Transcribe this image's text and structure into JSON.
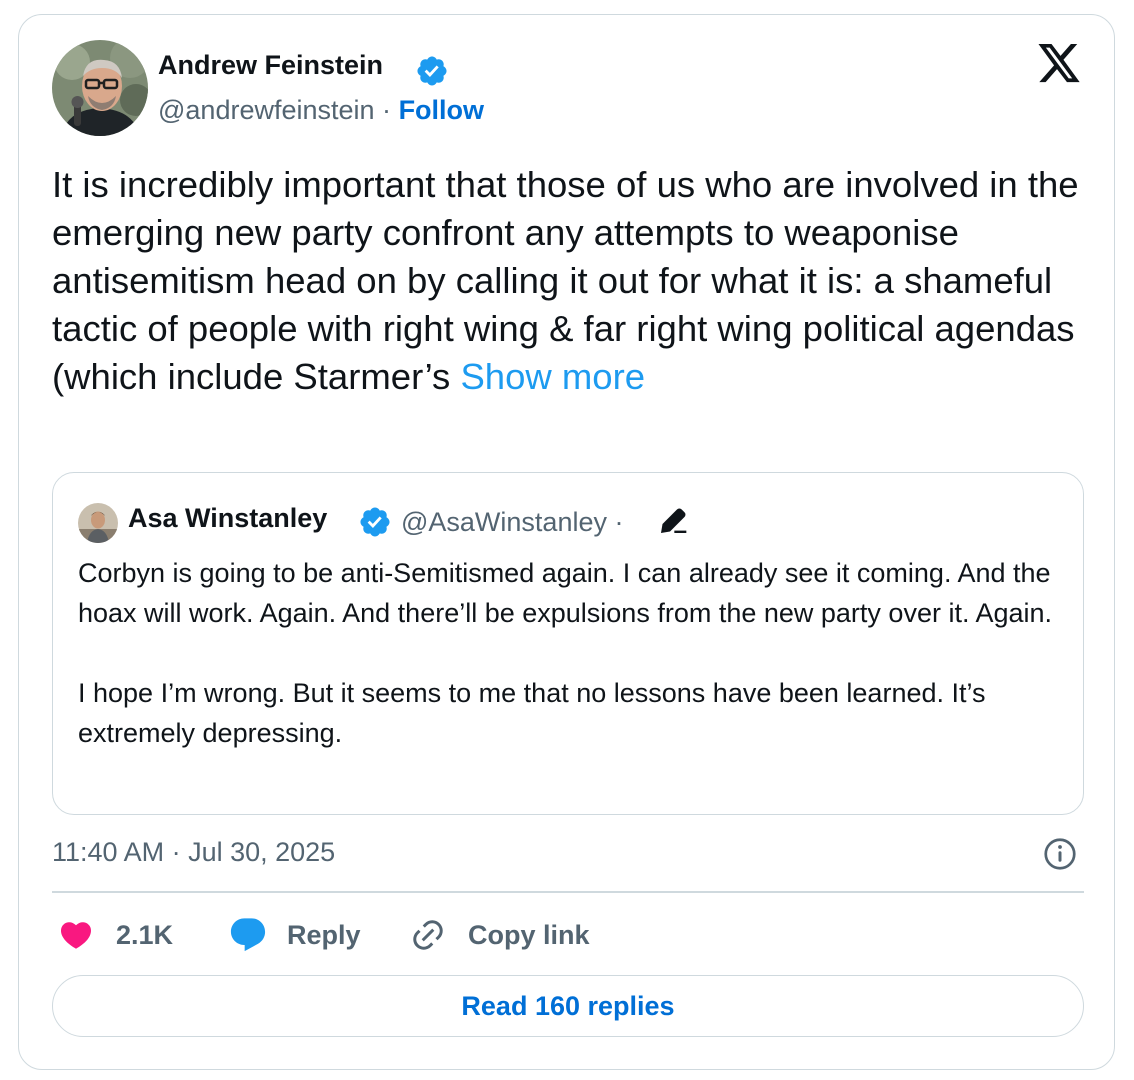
{
  "author": {
    "name": "Andrew Feinstein",
    "handle": "@andrewfeinstein",
    "separator": "·",
    "follow_label": "Follow"
  },
  "tweet": {
    "text": "It is incredibly important that those of us who are involved in the emerging new party confront any attempts to weaponise antisemitism head on by calling it out for what it is: a shameful tactic of people with right wing & far right wing political agendas (which include Starmer’s",
    "show_more_label": "Show more"
  },
  "quoted_tweet": {
    "name": "Asa Winstanley",
    "handle": "@AsaWinstanley",
    "separator": "·",
    "paragraphs": [
      "Corbyn is going to be anti-Semitismed again. I can already see it coming. And the hoax will work. Again. And there’ll be expulsions from the new party over it. Again.",
      "I hope I’m wrong. But it seems to me that no lessons have been learned. It’s extremely depressing."
    ]
  },
  "timestamp": "11:40 AM · Jul 30, 2025",
  "actions": {
    "like_count": "2.1K",
    "reply_label": "Reply",
    "copy_link_label": "Copy link"
  },
  "read_replies_label": "Read 160 replies",
  "colors": {
    "link_blue": "#006fd6",
    "show_more_blue": "#1d9bf0",
    "verified_blue": "#1d9bf0",
    "like_pink": "#f91880",
    "secondary_text": "#536471",
    "border": "#cfd9de"
  },
  "icons": {
    "brand": "x-logo-icon",
    "verified": "verified-badge-icon",
    "edited": "edit-pencil-icon",
    "info": "info-icon",
    "like": "heart-icon",
    "reply": "reply-bubble-icon",
    "copy_link": "link-icon"
  }
}
